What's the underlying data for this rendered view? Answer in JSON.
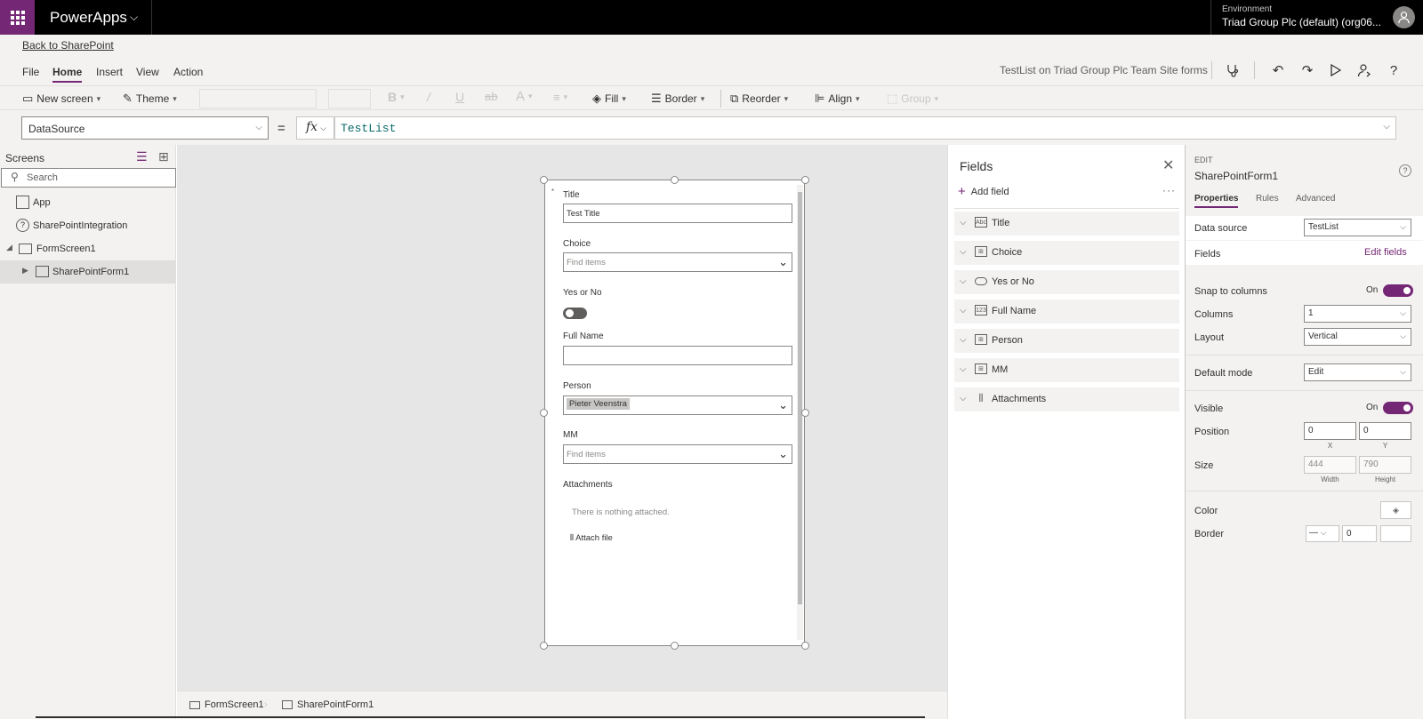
{
  "topbar": {
    "app_name": "PowerApps",
    "environment_label": "Environment",
    "environment_name": "Triad Group Plc (default) (org06..."
  },
  "header": {
    "back_link": "Back to SharePoint",
    "menu": [
      "File",
      "Home",
      "Insert",
      "View",
      "Action"
    ],
    "active_menu": "Home",
    "app_title": "TestList on Triad Group Plc Team Site forms"
  },
  "ribbon": {
    "new_screen": "New screen",
    "theme": "Theme",
    "fill": "Fill",
    "border": "Border",
    "reorder": "Reorder",
    "align": "Align",
    "group": "Group"
  },
  "formula": {
    "property": "DataSource",
    "equals": "=",
    "fx": "fx",
    "value": "TestList"
  },
  "tree": {
    "title": "Screens",
    "search_placeholder": "Search",
    "items": [
      "App",
      "SharePointIntegration",
      "FormScreen1",
      "SharePointForm1"
    ]
  },
  "form": {
    "fields": [
      {
        "label": "Title",
        "value": "Test Title"
      },
      {
        "label": "Choice",
        "placeholder": "Find items"
      },
      {
        "label": "Yes or No"
      },
      {
        "label": "Full Name",
        "value": ""
      },
      {
        "label": "Person",
        "value": "Pieter Veenstra"
      },
      {
        "label": "MM",
        "placeholder": "Find items"
      },
      {
        "label": "Attachments"
      }
    ],
    "required_marker": "*",
    "nothing_attached": "There is nothing attached.",
    "attach_file": "Attach file"
  },
  "bottom_bar": {
    "screen": "FormScreen1",
    "control": "SharePointForm1"
  },
  "fields_panel": {
    "title": "Fields",
    "add_field": "Add field",
    "items": [
      "Title",
      "Choice",
      "Yes or No",
      "Full Name",
      "Person",
      "MM",
      "Attachments"
    ]
  },
  "props_panel": {
    "mode_label": "EDIT",
    "control_name": "SharePointForm1",
    "tabs": [
      "Properties",
      "Rules",
      "Advanced"
    ],
    "data_source_label": "Data source",
    "data_source_value": "TestList",
    "fields_label": "Fields",
    "edit_fields_link": "Edit fields",
    "snap_label": "Snap to columns",
    "snap_value": "On",
    "columns_label": "Columns",
    "columns_value": "1",
    "layout_label": "Layout",
    "layout_value": "Vertical",
    "default_mode_label": "Default mode",
    "default_mode_value": "Edit",
    "visible_label": "Visible",
    "visible_value": "On",
    "position_label": "Position",
    "x_value": "0",
    "y_value": "0",
    "x_label": "X",
    "y_label": "Y",
    "size_label": "Size",
    "width_value": "444",
    "height_value": "790",
    "width_label": "Width",
    "height_label": "Height",
    "color_label": "Color",
    "border_label": "Border",
    "border_width_value": "0"
  },
  "colors": {
    "accent": "#742774",
    "topbar": "#000000",
    "canvas": "#e6e6e6"
  }
}
